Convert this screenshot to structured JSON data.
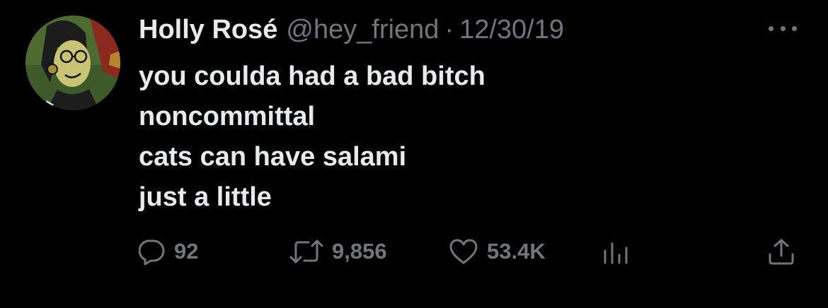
{
  "tweet": {
    "display_name": "Holly Rosé",
    "handle": "@hey_friend",
    "separator": "·",
    "date": "12/30/19",
    "lines": [
      "you coulda had a bad bitch",
      "noncommittal",
      "cats can have salami",
      "just a little"
    ]
  },
  "actions": {
    "reply_count": "92",
    "retweet_count": "9,856",
    "like_count": "53.4K"
  },
  "icons": {
    "reply": "reply-icon",
    "retweet": "retweet-icon",
    "like": "heart-icon",
    "views": "views-icon",
    "share": "share-icon",
    "more": "more-icon"
  },
  "colors": {
    "background": "#000000",
    "primary_text": "#e7e9ea",
    "secondary_text": "#71767b"
  }
}
